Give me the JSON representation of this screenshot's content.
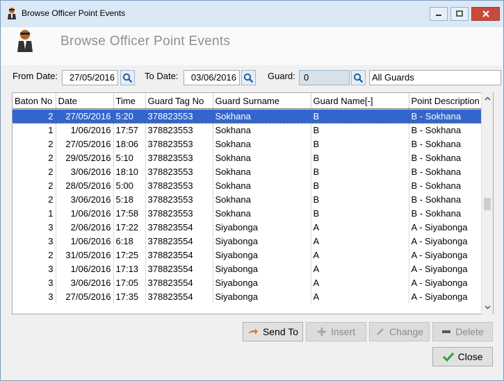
{
  "window": {
    "title": "Browse Officer Point Events",
    "heading": "Browse Officer Point Events"
  },
  "filters": {
    "from_label": "From Date:",
    "from_value": "27/05/2016",
    "to_label": "To Date:",
    "to_value": "03/06/2016",
    "guard_label": "Guard:",
    "guard_value": "0",
    "guard_name_value": "All Guards"
  },
  "table": {
    "columns": [
      "Baton No",
      "Date",
      "Time",
      "Guard Tag No",
      "Guard Surname",
      "Guard Name[-]",
      "Point Description"
    ],
    "rows": [
      [
        "2",
        "27/05/2016",
        "5:20",
        "378823553",
        "Sokhana",
        "B",
        "B - Sokhana"
      ],
      [
        "1",
        "1/06/2016",
        "17:57",
        "378823553",
        "Sokhana",
        "B",
        "B - Sokhana"
      ],
      [
        "2",
        "27/05/2016",
        "18:06",
        "378823553",
        "Sokhana",
        "B",
        "B - Sokhana"
      ],
      [
        "2",
        "29/05/2016",
        "5:10",
        "378823553",
        "Sokhana",
        "B",
        "B - Sokhana"
      ],
      [
        "2",
        "3/06/2016",
        "18:10",
        "378823553",
        "Sokhana",
        "B",
        "B - Sokhana"
      ],
      [
        "2",
        "28/05/2016",
        "5:00",
        "378823553",
        "Sokhana",
        "B",
        "B - Sokhana"
      ],
      [
        "2",
        "3/06/2016",
        "5:18",
        "378823553",
        "Sokhana",
        "B",
        "B - Sokhana"
      ],
      [
        "1",
        "1/06/2016",
        "17:58",
        "378823553",
        "Sokhana",
        "B",
        "B - Sokhana"
      ],
      [
        "3",
        "2/06/2016",
        "17:22",
        "378823554",
        "Siyabonga",
        "A",
        "A - Siyabonga"
      ],
      [
        "3",
        "1/06/2016",
        "6:18",
        "378823554",
        "Siyabonga",
        "A",
        "A - Siyabonga"
      ],
      [
        "2",
        "31/05/2016",
        "17:25",
        "378823554",
        "Siyabonga",
        "A",
        "A - Siyabonga"
      ],
      [
        "3",
        "1/06/2016",
        "17:13",
        "378823554",
        "Siyabonga",
        "A",
        "A - Siyabonga"
      ],
      [
        "3",
        "3/06/2016",
        "17:05",
        "378823554",
        "Siyabonga",
        "A",
        "A - Siyabonga"
      ],
      [
        "3",
        "27/05/2016",
        "17:35",
        "378823554",
        "Siyabonga",
        "A",
        "A - Siyabonga"
      ]
    ],
    "selected_row": 0
  },
  "buttons": {
    "send_to": "Send To",
    "insert": "Insert",
    "change": "Change",
    "delete": "Delete",
    "close": "Close"
  },
  "icons": {
    "app": "officer-icon",
    "search": "magnifier-icon",
    "send": "arrow-right-icon",
    "insert": "plus-icon",
    "change": "pencil-icon",
    "delete": "minus-icon",
    "close": "check-icon"
  },
  "colors": {
    "selection": "#3366cc",
    "close_button": "#c94a3d",
    "send_arrow": "#e8742c",
    "check": "#2e9e3e"
  }
}
